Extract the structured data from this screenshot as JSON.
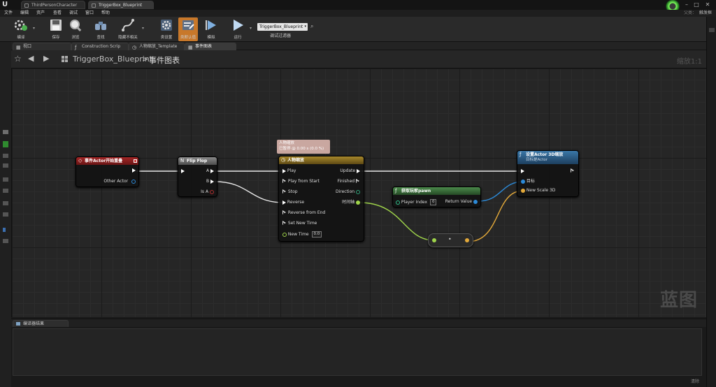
{
  "titlebar": {
    "tabs": [
      {
        "label": "ThirdPersonCharacter"
      },
      {
        "label": "TriggerBox_Blueprint"
      }
    ]
  },
  "menubar": {
    "items": [
      "文件",
      "编辑",
      "资产",
      "查看",
      "调试",
      "窗口",
      "帮助"
    ],
    "search_label": "父类：",
    "parent_class": "触发框"
  },
  "toolbar": {
    "buttons": [
      {
        "label": "编译"
      },
      {
        "label": "保存"
      },
      {
        "label": "浏览"
      },
      {
        "label": "查找"
      },
      {
        "label": "隐藏不相关"
      },
      {
        "label": "类设置"
      },
      {
        "label": "类默认值"
      },
      {
        "label": "模拟"
      },
      {
        "label": "运行"
      }
    ],
    "debug_object": "TriggerBox_Blueprint",
    "debug_filter_label": "调试过滤器"
  },
  "graph_tabs": [
    {
      "label": "视口",
      "icon": "viewport"
    },
    {
      "label": "Construction Scrip",
      "icon": "function"
    },
    {
      "label": "人物缩放_Template",
      "icon": "timeline"
    },
    {
      "label": "事件图表",
      "icon": "graph"
    }
  ],
  "breadcrumb": {
    "blueprint": "TriggerBox_Blueprint",
    "separator": ">",
    "current": "事件图表",
    "zoom": "缩放1:1"
  },
  "watermark": "蓝图",
  "nodes": {
    "event": {
      "title": "事件Actor开始重叠",
      "pin_other": "Other Actor",
      "color": "#8a1d1d"
    },
    "flipflop": {
      "title": "Flip Flop",
      "pin_a": "A",
      "pin_b": "B",
      "pin_isa": "Is A",
      "color": "#6f6f6f"
    },
    "timeline": {
      "comment_title": "人物缩放",
      "comment_status": "已暂停 @ 0.00 s (0.0 %)",
      "title": "人物缩放",
      "inputs": [
        "Play",
        "Play from Start",
        "Stop",
        "Reverse",
        "Reverse from End",
        "Set New Time"
      ],
      "new_time_label": "New Time",
      "new_time_value": "0.0",
      "outputs": [
        "Update",
        "Finished",
        "Direction",
        "时间轴"
      ],
      "color": "#8a6f1f"
    },
    "get_player": {
      "title": "获取玩家pawn",
      "player_index_label": "Player Index",
      "player_index_value": "0",
      "return_value": "Return Value",
      "color": "#386b38"
    },
    "set_scale": {
      "title": "设置Actor 3D缩放",
      "subtitle": "目标是Actor",
      "target": "目标",
      "new_scale": "New Scale 3D",
      "color": "#2d5b82"
    },
    "make_vector": {
      "symbol": "•"
    }
  },
  "bottom_panel": {
    "tab": "编译器结果",
    "clear": "清除"
  }
}
